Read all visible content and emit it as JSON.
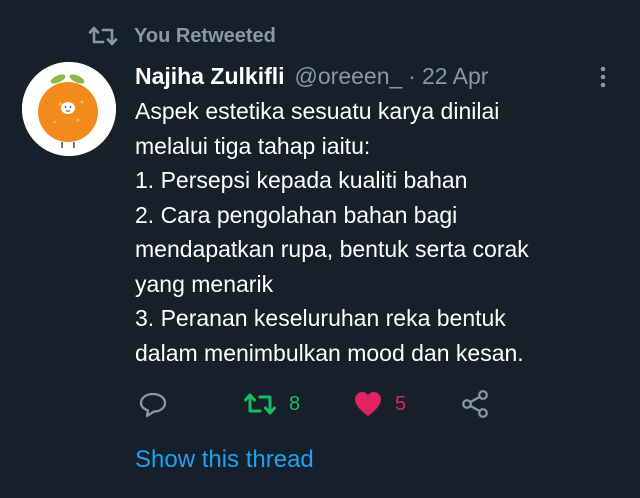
{
  "retweet_banner": {
    "label": "You Retweeted",
    "icon": "retweet-icon"
  },
  "tweet": {
    "author_name": "Najiha Zulkifli",
    "handle": "@oreeen_",
    "separator": "·",
    "date": "22 Apr",
    "text_lines": [
      "Aspek estetika sesuatu karya dinilai",
      "melalui tiga tahap iaitu:",
      "1. Persepsi kepada kualiti bahan",
      "2. Cara pengolahan bahan bagi",
      "mendapatkan rupa, bentuk serta corak",
      "yang menarik",
      "3. Peranan keseluruhan reka bentuk",
      "dalam menimbulkan mood dan kesan."
    ]
  },
  "actions": {
    "retweet_count": "8",
    "like_count": "5"
  },
  "show_thread": "Show this thread",
  "colors": {
    "background": "#15202b",
    "muted": "#8899a6",
    "retweet_green": "#17bf63",
    "like_red": "#e0245e",
    "link_blue": "#1da1f2"
  }
}
